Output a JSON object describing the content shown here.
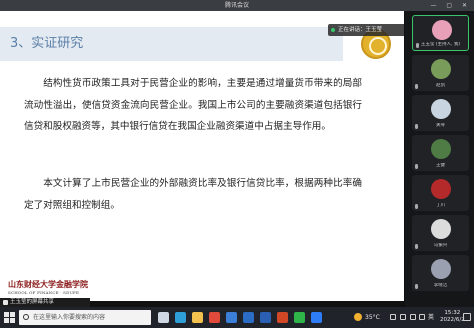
{
  "window": {
    "title": "腾讯会议",
    "controls": "— ▢ ✕"
  },
  "slide": {
    "title": "3、实证研究",
    "speaker_tag": "正在讲话：王玉莹",
    "paragraphs": [
      "结构性货币政策工具对于民营企业的影响，主要是通过增量货币带来的局部流动性溢出，使信贷资金流向民营企业。我国上市公司的主要融资渠道包括银行信贷和股权融资等，其中银行信贷在我国企业融资渠道中占据主导作用。",
      "本文计算了上市民营企业的外部融资比率及银行信贷比率，根据两种比率确定了对照组和控制组。"
    ],
    "school": {
      "name_cn": "山东财经大学金融学院",
      "name_en": "SCHOOL OF FINANCE · SDUFE"
    }
  },
  "share_bar": {
    "label": "王玉莹的屏幕共享"
  },
  "participants": [
    {
      "name": "王玉莹 (主持人, 我)",
      "avatar_color": "#e8a0b8",
      "active": true
    },
    {
      "name": "赵凯",
      "avatar_color": "#7a9c5a",
      "active": false
    },
    {
      "name": "关琴",
      "avatar_color": "#c8d4e0",
      "active": false
    },
    {
      "name": "王健",
      "avatar_color": "#4f7b45",
      "active": false
    },
    {
      "name": "丁川",
      "avatar_color": "#b42a2a",
      "active": false
    },
    {
      "name": "马振兴",
      "avatar_color": "#dcdcdc",
      "active": false
    },
    {
      "name": "李晓洁",
      "avatar_color": "#9aa0b0",
      "active": false
    }
  ],
  "taskbar": {
    "search_placeholder": "在这里输入你要搜索的内容",
    "apps": [
      {
        "name": "task-view-icon",
        "color": "#cfd8e3"
      },
      {
        "name": "edge-icon",
        "color": "#2f9fd8"
      },
      {
        "name": "file-explorer-icon",
        "color": "#f2c14e"
      },
      {
        "name": "chrome-icon",
        "color": "#e04a3b"
      },
      {
        "name": "store-icon",
        "color": "#3b7fd8"
      },
      {
        "name": "mail-icon",
        "color": "#2b6cc4"
      },
      {
        "name": "word-icon",
        "color": "#2b5fb4"
      },
      {
        "name": "powerpoint-icon",
        "color": "#d24726"
      },
      {
        "name": "wechat-icon",
        "color": "#2fb44a"
      },
      {
        "name": "tencent-meeting-icon",
        "color": "#2e7cf6"
      }
    ],
    "weather": "35°C",
    "ime": "英",
    "time": "15:32",
    "date": "2022/6/2"
  }
}
